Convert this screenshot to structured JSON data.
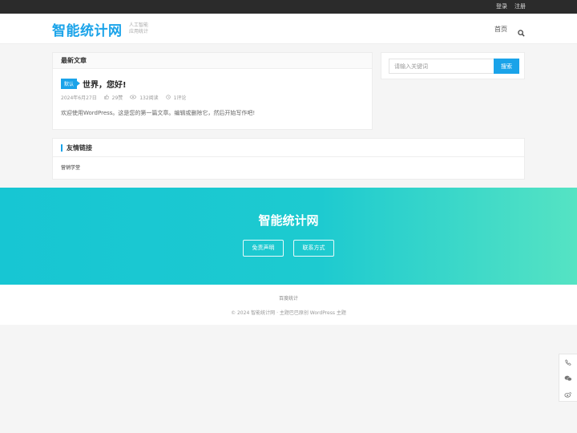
{
  "topbar": {
    "login": "登录",
    "register": "注册"
  },
  "header": {
    "logo": "智能统计网",
    "tagline_1": "人工智能",
    "tagline_2": "应用统计",
    "nav_home": "首页"
  },
  "posts": {
    "heading": "最新文章",
    "items": [
      {
        "badge": "默认",
        "title": "世界，您好!",
        "date": "2024年6月27日",
        "likes": "29赞",
        "views": "132阅读",
        "comments": "1评论",
        "excerpt": "欢迎使用WordPress。这是您的第一篇文章。编辑或删除它，然后开始写作吧!"
      }
    ]
  },
  "search": {
    "placeholder": "请输入关键词",
    "button": "搜索"
  },
  "links": {
    "heading": "友情链接",
    "items": [
      "营销学堂"
    ]
  },
  "banner": {
    "title": "智能统计网",
    "disclaimer": "免责声明",
    "contact": "联系方式"
  },
  "footer": {
    "link": "百度统计",
    "copyright": "© 2024 智能统计网 · 主题巴巴原创 WordPress 主题"
  },
  "colors": {
    "accent": "#1aa3e9",
    "topbar": "#2b2b2b",
    "banner_start": "#17c6d3",
    "banner_end": "#55e3c3"
  },
  "icons": [
    "search-icon",
    "thumb-up-icon",
    "eye-icon",
    "comment-icon",
    "phone-icon",
    "wechat-icon",
    "weibo-icon"
  ]
}
